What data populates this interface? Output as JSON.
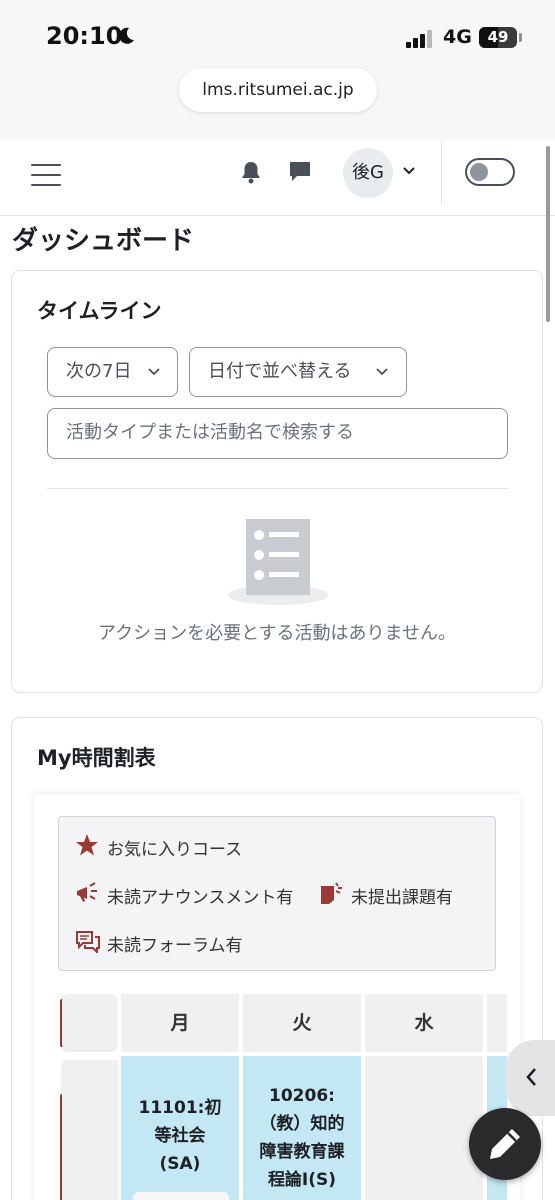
{
  "status_bar": {
    "time": "20:10",
    "network": "4G",
    "battery_level": "49",
    "battery_fraction": 0.49,
    "url": "lms.ritsumei.ac.jp"
  },
  "navbar": {
    "user_initials": "後G",
    "dark_mode_enabled": false
  },
  "page": {
    "title": "ダッシュボード"
  },
  "timeline": {
    "title": "タイムライン",
    "range_filter": "次の7日",
    "sort_filter": "日付で並べ替える",
    "search_placeholder": "活動タイプまたは活動名で検索する",
    "empty_message": "アクションを必要とする活動はありません。"
  },
  "timetable": {
    "title": "My時間割表",
    "legend": {
      "favorite": "お気に入りコース",
      "unread_announcement": "未読アナウンスメント有",
      "unsubmitted": "未提出課題有",
      "unread_forum": "未読フォーラム有"
    },
    "days": [
      "月",
      "火",
      "水"
    ],
    "row1": [
      {
        "lines": [
          "11101:初",
          "等社会",
          "(SA)"
        ]
      },
      {
        "lines": [
          "10206:",
          "（教）知的",
          "障害教育課",
          "程論I(S)"
        ]
      },
      {
        "lines": []
      }
    ]
  },
  "colors": {
    "accent_red": "#9b3a34",
    "course_cell": "#c3e7f3",
    "border": "#dee2e6"
  },
  "icons": [
    "moon-icon",
    "signal-icon",
    "menu-icon",
    "bell-icon",
    "chat-icon",
    "chevron-down-icon",
    "star-icon",
    "megaphone-icon",
    "assignment-icon",
    "forum-icon",
    "chevron-left-icon",
    "pencil-icon",
    "task-list-icon"
  ]
}
